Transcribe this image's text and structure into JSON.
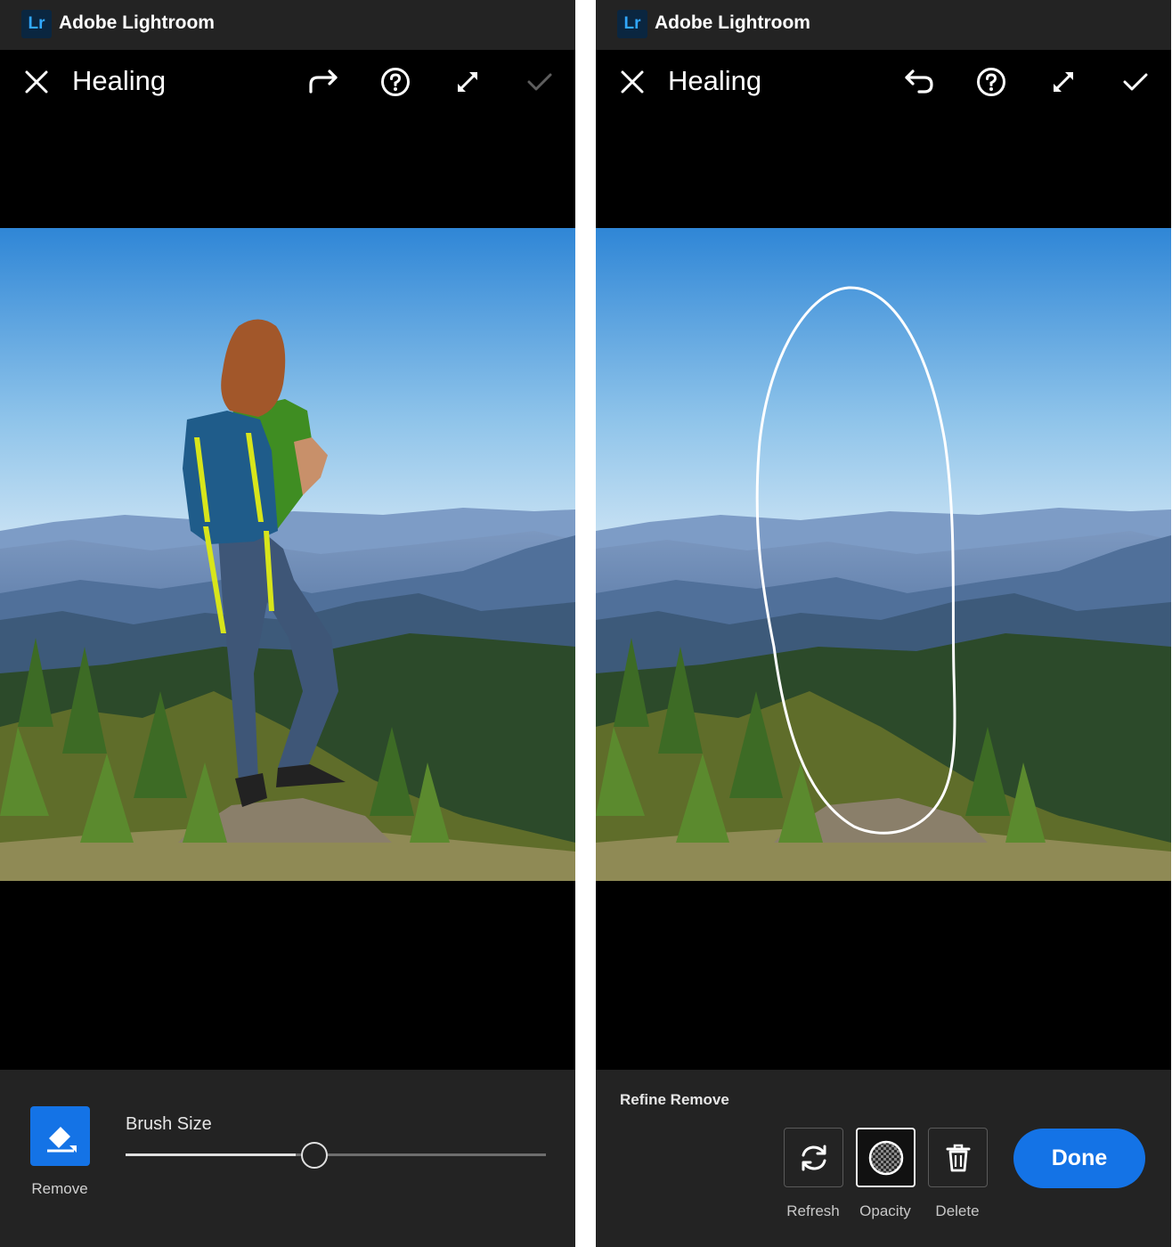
{
  "left": {
    "app_title": "Adobe Lightroom",
    "logo_text": "Lr",
    "tool_title": "Healing",
    "tool_label": "Remove",
    "brush_label": "Brush Size",
    "brush_size_level": 0.45,
    "icons": [
      "close-icon",
      "redo-icon",
      "help-icon",
      "expand-icon",
      "check-icon"
    ],
    "check_enabled": false
  },
  "right": {
    "app_title": "Adobe Lightroom",
    "logo_text": "Lr",
    "tool_title": "Healing",
    "refine_title": "Refine  Remove",
    "buttons": [
      {
        "label": "Refresh",
        "icon": "refresh-icon"
      },
      {
        "label": "Opacity",
        "icon": "opacity-icon",
        "selected": true
      },
      {
        "label": "Delete",
        "icon": "trash-icon"
      }
    ],
    "done_label": "Done",
    "icons": [
      "close-icon",
      "undo-icon",
      "help-icon",
      "expand-icon",
      "check-icon"
    ],
    "check_enabled": true
  },
  "colors": {
    "accent": "#1473e6",
    "panel": "#232323",
    "logo_bg": "#0a2640",
    "logo_text": "#31a8ff"
  }
}
